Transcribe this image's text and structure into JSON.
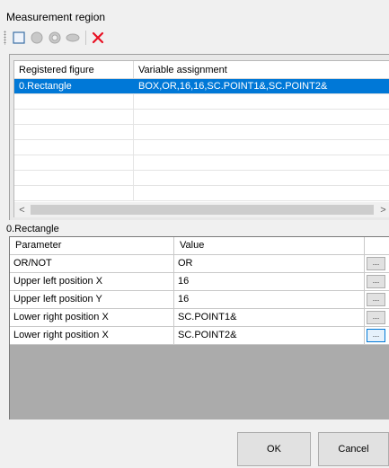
{
  "window": {
    "title": "Measurement region"
  },
  "toolbar": {
    "buttons": [
      {
        "icon": "rectangle-icon"
      },
      {
        "icon": "circle-icon"
      },
      {
        "icon": "ring-icon"
      },
      {
        "icon": "ellipse-icon"
      },
      {
        "icon": "delete-icon"
      }
    ],
    "delete_color": "#e81123"
  },
  "figures": {
    "columns": [
      "Registered figure",
      "Variable assignment"
    ],
    "rows": [
      {
        "figure": "0.Rectangle",
        "assignment": "BOX,OR,16,16,SC.POINT1&,SC.POINT2&",
        "selected": true
      }
    ],
    "scroll_left": "<",
    "scroll_right": ">"
  },
  "selected_figure_label": "0.Rectangle",
  "parameters": {
    "columns": [
      "Parameter",
      "Value"
    ],
    "rows": [
      {
        "name": "OR/NOT",
        "value": "OR",
        "button": "..."
      },
      {
        "name": "Upper left position X",
        "value": "16",
        "button": "..."
      },
      {
        "name": "Upper left position Y",
        "value": "16",
        "button": "..."
      },
      {
        "name": "Lower right position X",
        "value": "SC.POINT1&",
        "button": "..."
      },
      {
        "name": "Lower right position X",
        "value": "SC.POINT2&",
        "button": "..."
      }
    ]
  },
  "buttons": {
    "ok": "OK",
    "cancel": "Cancel"
  },
  "colors": {
    "selection": "#0078d7",
    "grid_background": "#ababab"
  }
}
